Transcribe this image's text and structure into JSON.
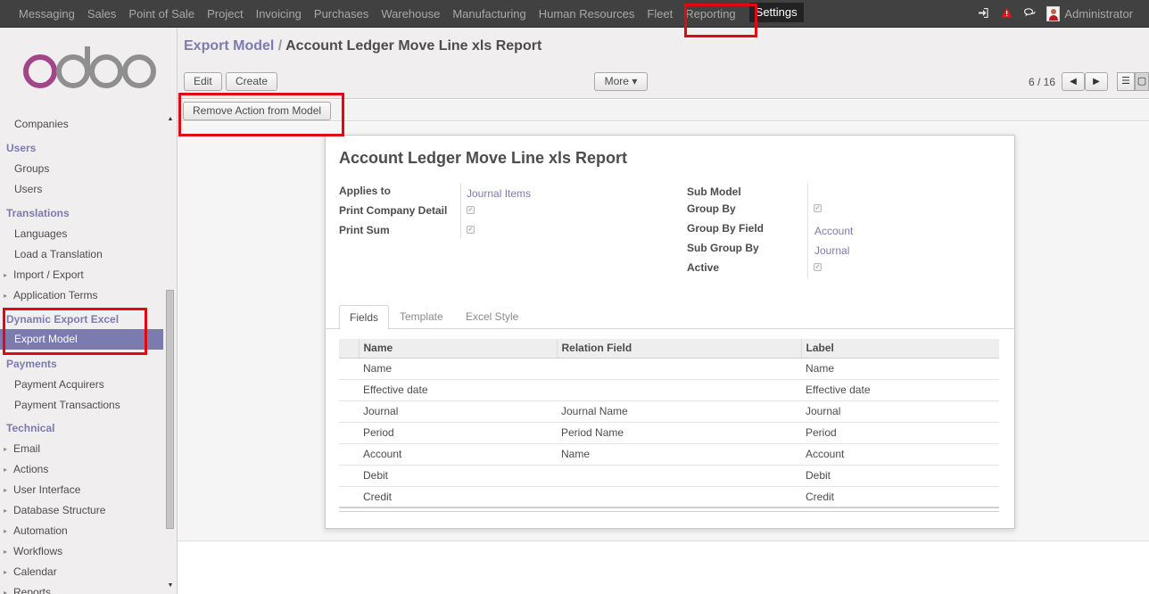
{
  "topbar": {
    "menu": [
      "Messaging",
      "Sales",
      "Point of Sale",
      "Project",
      "Invoicing",
      "Purchases",
      "Warehouse",
      "Manufacturing",
      "Human Resources",
      "Fleet",
      "Reporting",
      "Settings"
    ],
    "active": "Settings",
    "icons": [
      "sign-in-icon",
      "warning-icon",
      "chat-icon"
    ],
    "user": "Administrator"
  },
  "sidebar": {
    "logo": "odoo",
    "companies": "Companies",
    "users_head": "Users",
    "groups": "Groups",
    "users": "Users",
    "translations_head": "Translations",
    "languages": "Languages",
    "load_translation": "Load a Translation",
    "import_export": "Import / Export",
    "application_terms": "Application Terms",
    "dynamic_head": "Dynamic Export Excel",
    "export_model": "Export Model",
    "payments_head": "Payments",
    "payment_acquirers": "Payment Acquirers",
    "payment_transactions": "Payment Transactions",
    "technical_head": "Technical",
    "email": "Email",
    "actions": "Actions",
    "user_interface": "User Interface",
    "database_structure": "Database Structure",
    "automation": "Automation",
    "workflows": "Workflows",
    "calendar": "Calendar",
    "reports": "Reports"
  },
  "header": {
    "crumb_parent": "Export Model",
    "crumb_sep": "/",
    "crumb_current": "Account Ledger Move Line xls Report",
    "edit": "Edit",
    "create": "Create",
    "more": "More ▾",
    "pager": "6 / 16",
    "remove_action": "Remove Action from Model"
  },
  "form": {
    "title": "Account Ledger Move Line xls Report",
    "applies_to_label": "Applies to",
    "applies_to_value": "Journal Items",
    "print_company_detail_label": "Print Company Detail",
    "print_company_detail": true,
    "print_sum_label": "Print Sum",
    "print_sum": true,
    "sub_model_label": "Sub Model",
    "group_by_label": "Group By",
    "group_by": true,
    "group_by_field_label": "Group By Field",
    "group_by_field_value": "Account",
    "sub_group_by_label": "Sub Group By",
    "sub_group_by_value": "Journal",
    "active_label": "Active",
    "active": true
  },
  "tabs": [
    "Fields",
    "Template",
    "Excel Style"
  ],
  "fields_table": {
    "columns": [
      "Name",
      "Relation Field",
      "Label"
    ],
    "rows": [
      [
        "Name",
        "",
        "Name"
      ],
      [
        "Effective date",
        "",
        "Effective date"
      ],
      [
        "Journal",
        "Journal Name",
        "Journal"
      ],
      [
        "Period",
        "Period Name",
        "Period"
      ],
      [
        "Account",
        "Name",
        "Account"
      ],
      [
        "Debit",
        "",
        "Debit"
      ],
      [
        "Credit",
        "",
        "Credit"
      ]
    ]
  },
  "colors": {
    "accent": "#7c7bad",
    "topbar": "#414141",
    "highlight": "#e30613"
  }
}
